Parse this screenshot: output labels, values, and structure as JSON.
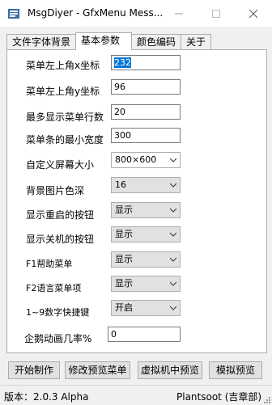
{
  "window": {
    "title": "MsgDiyer - GfxMenu Mess..."
  },
  "tabs": [
    {
      "label": "文件字体背景"
    },
    {
      "label": "基本参数"
    },
    {
      "label": "颜色编码"
    },
    {
      "label": "关于"
    }
  ],
  "fields": [
    {
      "label": "菜单左上角x坐标",
      "value": "232"
    },
    {
      "label": "菜单左上角y坐标",
      "value": "96"
    },
    {
      "label": "最多显示菜单行数",
      "value": "20"
    },
    {
      "label": "菜单条的最小宽度",
      "value": "300"
    },
    {
      "label": "自定义屏幕大小",
      "value": "800×600"
    },
    {
      "label": "背景图片色深",
      "value": "16"
    },
    {
      "label": "显示重启的按钮",
      "value": "显示"
    },
    {
      "label": "显示关机的按钮",
      "value": "显示"
    },
    {
      "label": "F1帮助菜单",
      "value": "显示"
    },
    {
      "label": "F2语言菜单项",
      "value": "显示"
    },
    {
      "label": "1~9数字快捷键",
      "value": "开启"
    },
    {
      "label": "企鹅动画几率%",
      "value": "0"
    }
  ],
  "buttons": {
    "start": "开始制作",
    "modify": "修改预览菜单",
    "vm_preview": "虚拟机中预览",
    "sim_preview": "模拟预览"
  },
  "status": {
    "version": "版本：2.0.3 Alpha",
    "author": "Plantsoot (吉章部)"
  },
  "colors": {
    "selection": "#0078d7",
    "window_bg": "#f0f0f0"
  }
}
